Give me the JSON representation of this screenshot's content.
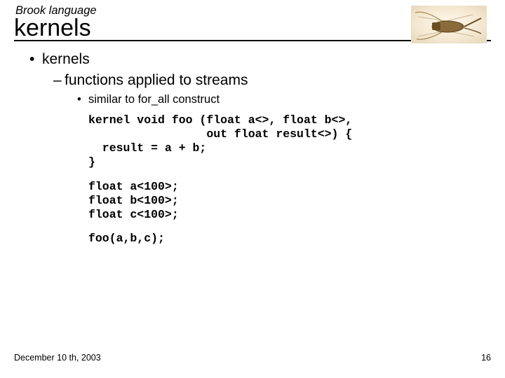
{
  "header": {
    "subtitle": "Brook language",
    "title": "kernels"
  },
  "bullets": {
    "l1": "kernels",
    "l2": "functions applied to streams",
    "l3": "similar to for_all construct"
  },
  "code": {
    "block1": "kernel void foo (float a<>, float b<>,\n                 out float result<>) {\n  result = a + b;\n}",
    "block2": "float a<100>;\nfloat b<100>;\nfloat c<100>;",
    "block3": "foo(a,b,c);"
  },
  "footer": {
    "date": "December 10 th, 2003",
    "page": "16"
  }
}
